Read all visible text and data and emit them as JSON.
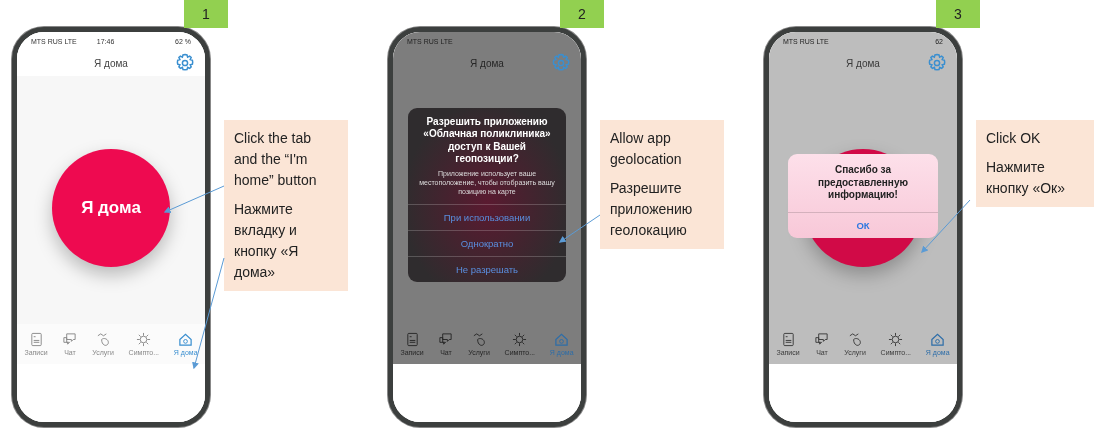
{
  "steps": [
    {
      "number": "1",
      "status_bar": {
        "carrier": "MTS RUS LTE",
        "time": "17:46",
        "battery": "62 %"
      },
      "header_title": "Я дома",
      "screen": {
        "kind": "home",
        "button_label": "Я дома"
      },
      "tabs": [
        {
          "label": "Записи",
          "selected": false
        },
        {
          "label": "Чат",
          "selected": false
        },
        {
          "label": "Услуги",
          "selected": false
        },
        {
          "label": "Симпто...",
          "selected": false
        },
        {
          "label": "Я дома",
          "selected": true
        }
      ],
      "callout": {
        "lines": [
          "Click the tab and the “I'm home” button",
          "Нажмите вкладку и кнопку «Я дома»"
        ]
      }
    },
    {
      "number": "2",
      "status_bar": {
        "carrier": "MTS RUS LTE"
      },
      "header_title": "Я дома",
      "screen": {
        "kind": "blank"
      },
      "tabs": [
        {
          "label": "Записи",
          "selected": false
        },
        {
          "label": "Чат",
          "selected": false
        },
        {
          "label": "Услуги",
          "selected": false
        },
        {
          "label": "Симпто...",
          "selected": false
        },
        {
          "label": "Я дома",
          "selected": true
        }
      ],
      "dialog": {
        "kind": "permission",
        "title": "Разрешить приложению «Облачная поликлиника» доступ к Вашей геопозиции?",
        "message": "Приложение использует ваше местоположение, чтобы отобразить вашу позицию на карте",
        "actions": [
          "При использовании",
          "Однократно",
          "Не разрешать"
        ]
      },
      "callout": {
        "lines": [
          "Allow app geolocation",
          "Разрешите приложению геолокацию"
        ]
      }
    },
    {
      "number": "3",
      "status_bar": {
        "carrier": "MTS RUS LTE",
        "battery": "62"
      },
      "header_title": "Я дома",
      "screen": {
        "kind": "home"
      },
      "tabs": [
        {
          "label": "Записи",
          "selected": false
        },
        {
          "label": "Чат",
          "selected": false
        },
        {
          "label": "Услуги",
          "selected": false
        },
        {
          "label": "Симпто...",
          "selected": false
        },
        {
          "label": "Я дома",
          "selected": true
        }
      ],
      "dialog": {
        "kind": "alert",
        "title": "Спасибо за предоставленную информацию!",
        "actions": [
          "ОК"
        ]
      },
      "callout": {
        "lines": [
          "Click OK",
          "Нажмите кнопку «Ок»"
        ]
      }
    }
  ]
}
